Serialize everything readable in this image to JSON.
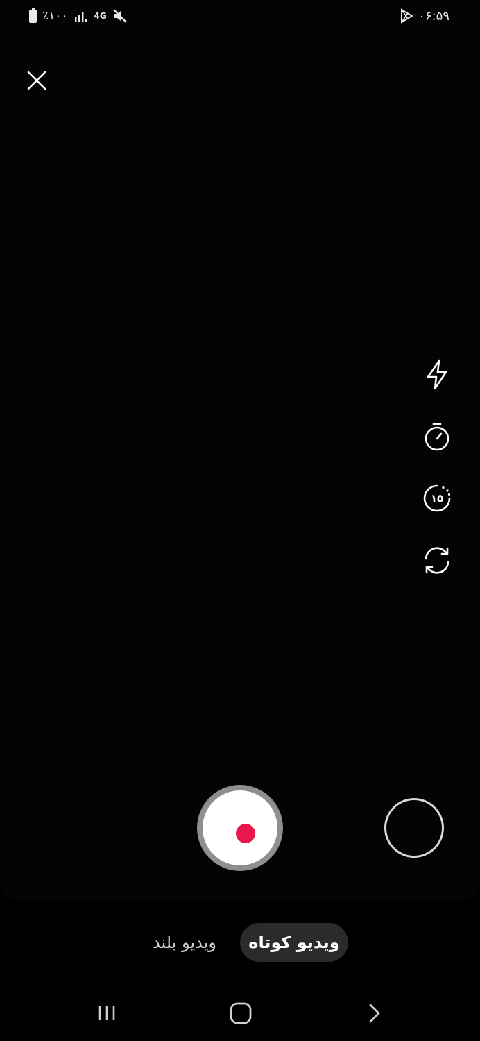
{
  "status_bar": {
    "battery_text": "٪۱۰۰",
    "network_type": "4G",
    "time": "۰۶:۵۹",
    "icons": [
      "battery-icon",
      "signal-icon",
      "mute-icon",
      "play-store-icon"
    ]
  },
  "camera": {
    "close_icon": "close-icon",
    "side_tools": [
      "flash-icon",
      "timer-icon",
      "duration-15s-icon",
      "flip-camera-icon"
    ],
    "duration_label": "۱۵",
    "record_color": "#e8174d"
  },
  "modes": {
    "long_video": "ویدیو بلند",
    "short_video": "ویدیو کوتاه",
    "selected": "short_video"
  },
  "nav": {
    "icons": [
      "recent-apps-icon",
      "home-icon",
      "back-icon"
    ]
  }
}
